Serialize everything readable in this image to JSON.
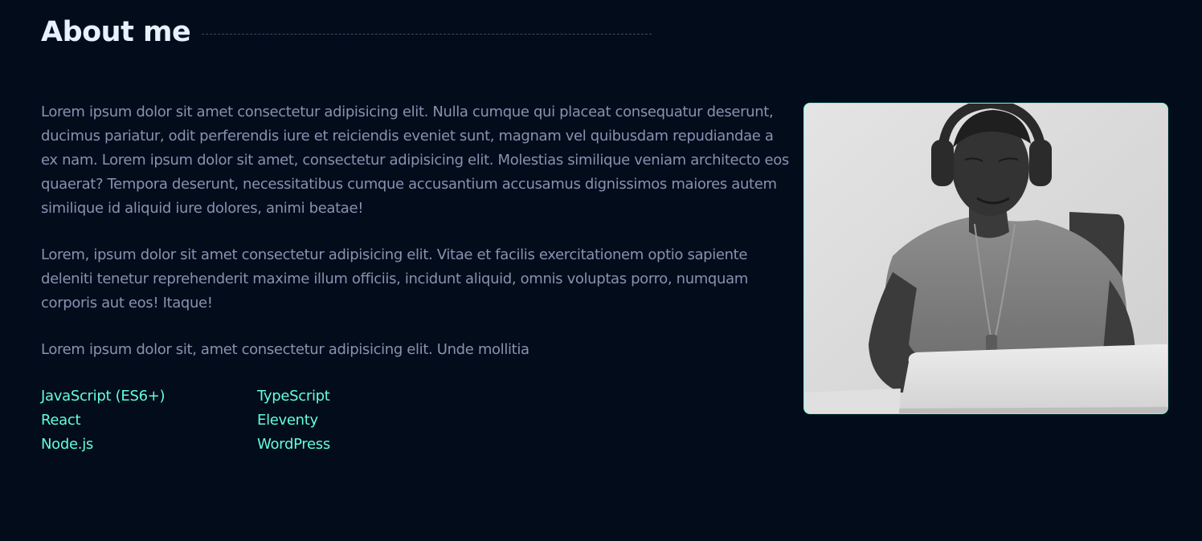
{
  "about": {
    "heading": "About me",
    "paragraphs": [
      "Lorem ipsum dolor sit amet consectetur adipisicing elit. Nulla cumque qui placeat consequatur deserunt, ducimus pariatur, odit perferendis iure et reiciendis eveniet sunt, magnam vel quibusdam repudiandae a ex nam. Lorem ipsum dolor sit amet, consectetur adipisicing elit. Molestias similique veniam architecto eos quaerat? Tempora deserunt, necessitatibus cumque accusantium accusamus dignissimos maiores autem similique id aliquid iure dolores, animi beatae!",
      "Lorem, ipsum dolor sit amet consectetur adipisicing elit. Vitae et facilis exercitationem optio sapiente deleniti tenetur reprehenderit maxime illum officiis, incidunt aliquid, omnis voluptas porro, numquam corporis aut eos! Itaque!",
      "Lorem ipsum dolor sit, amet consectetur adipisicing elit. Unde mollitia"
    ],
    "skills": [
      "JavaScript (ES6+)",
      "TypeScript",
      "React",
      "Eleventy",
      "Node.js",
      "WordPress"
    ]
  },
  "colors": {
    "background": "#020c1b",
    "heading": "#e6f1ff",
    "body_text": "#8892b0",
    "accent": "#64ffda",
    "divider": "#3f4a5e"
  },
  "image": {
    "icon": "portrait-photo",
    "style": "grayscale"
  }
}
